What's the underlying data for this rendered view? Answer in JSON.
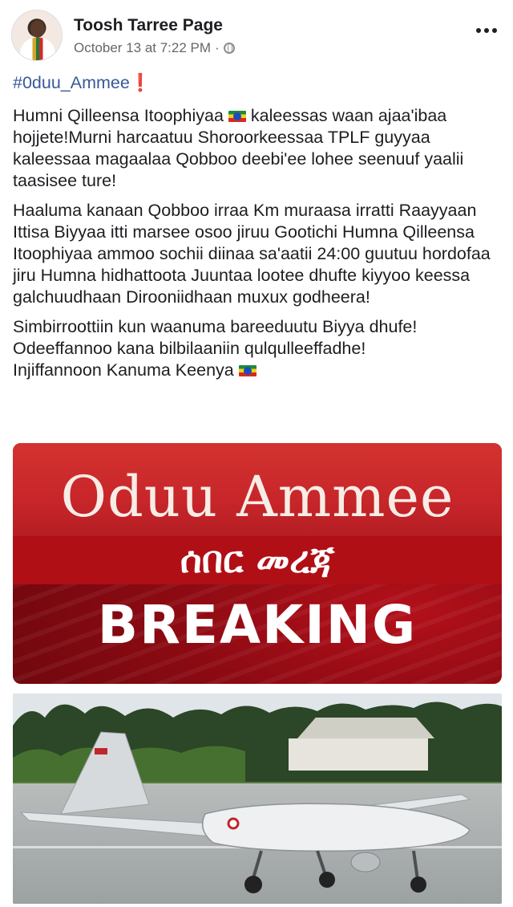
{
  "post": {
    "page_name": "Toosh Tarree Page",
    "timestamp": "October 13 at 7:22 PM",
    "separator": "·",
    "privacy_icon": "globe-icon",
    "more_icon": "more-horizontal-icon",
    "hashtag": "#0duu_Ammee",
    "hashtag_mark": "❗",
    "paragraph_1_part_1": "Humni Qilleensa Itoophiyaa ",
    "paragraph_1_part_2": " kaleessas waan ajaa'ibaa hojjete!Murni harcaatuu Shoroorkeessaa TPLF guyyaa kaleessaa magaalaa Qobboo deebi'ee lohee seenuuf yaalii taasisee ture!",
    "paragraph_2": "Haaluma kanaan Qobboo irraa Km muraasa irratti Raayyaan Ittisa Biyyaa itti marsee osoo jiruu Gootichi Humna Qilleensa Itoophiyaa ammoo sochii diinaa sa'aatii 24:00 guutuu hordofaa jiru Humna hidhattoota Juuntaa lootee dhufte kiyyoo keessa galchuudhaan Dirooniidhaan muxux godheera!",
    "paragraph_3_line_1": "Simbirroottiin kun waanuma bareeduutu Biyya dhufe!",
    "paragraph_3_line_2": "Odeeffannoo kana bilbilaaniin qulqulleeffadhe!",
    "paragraph_3_line_3": "Injiffannoon Kanuma Keenya ",
    "flag_icon": "ethiopian-flag-emoji"
  },
  "banner": {
    "line_1": "Oduu Ammee",
    "line_2": "ሰበር መረጃ",
    "line_3": "BREAKING",
    "colors": {
      "red": "#c8262a",
      "dark_red": "#8a0a12",
      "text": "#ffffff"
    }
  },
  "photo": {
    "subject": "drone-aircraft-on-tarmac",
    "aircraft_icon": "drone-icon"
  },
  "colors": {
    "link": "#385898",
    "meta_text": "#65676b",
    "body_text": "#1c1e21"
  }
}
